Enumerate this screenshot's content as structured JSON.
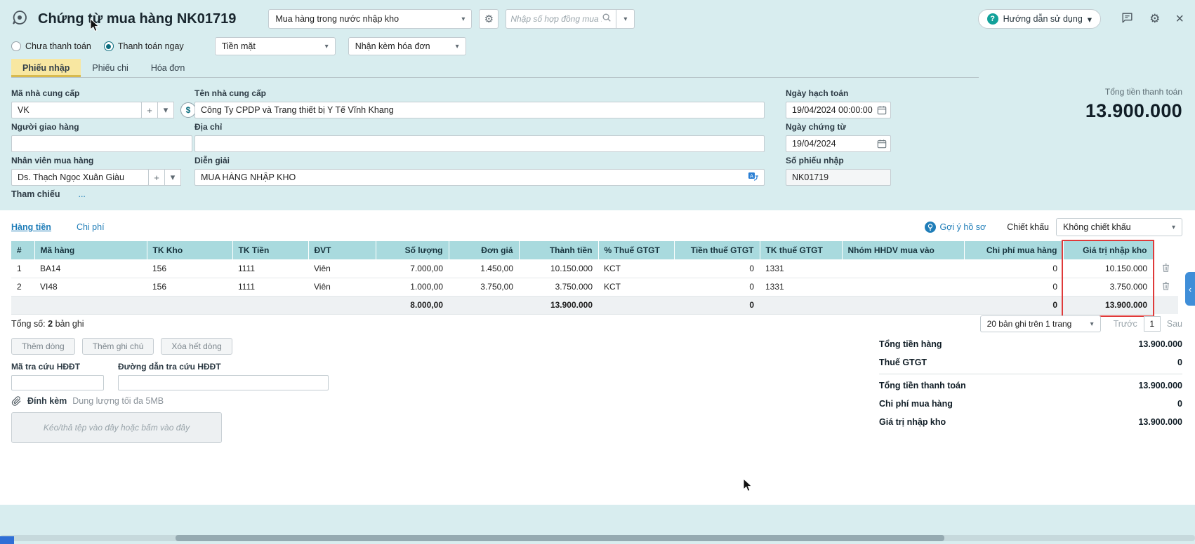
{
  "colors": {
    "background": "#d8edef",
    "table_header": "#a9dade",
    "active_tab_yellow": "#f8e7a1",
    "link_blue": "#1f7db8",
    "highlight_red": "#df3a3a",
    "side_tab_blue": "#3f8ed8"
  },
  "icons": {
    "gear": "⚙",
    "close": "×",
    "chevron_down": "▾",
    "chevron_left": "‹",
    "plus": "+",
    "dollar": "$",
    "question": "?"
  },
  "header": {
    "title": "Chứng từ mua hàng NK01719",
    "doc_type": "Mua hàng trong nước nhập kho",
    "contract_search_placeholder": "Nhập số hợp đồng mua ...",
    "help": "Hướng dẫn sử dụng"
  },
  "payment": {
    "option_unpaid": "Chưa thanh toán",
    "option_paid_now": "Thanh toán ngay",
    "selected_option": "Thanh toán ngay",
    "method": "Tiền mặt",
    "invoice_mode": "Nhận kèm hóa đơn"
  },
  "tabs": [
    "Phiếu nhập",
    "Phiếu chi",
    "Hóa đơn"
  ],
  "active_tab": "Phiếu nhập",
  "form": {
    "supplier_code_label": "Mã nhà cung cấp",
    "supplier_code": "VK",
    "supplier_name_label": "Tên nhà cung cấp",
    "supplier_name": "Công Ty CPDP và Trang thiết bị Y Tế Vĩnh Khang",
    "posting_date_label": "Ngày hạch toán",
    "posting_date": "19/04/2024 00:00:00",
    "total_payment_label": "Tổng tiền thanh toán",
    "total_payment": "13.900.000",
    "deliverer_label": "Người giao hàng",
    "deliverer": "",
    "address_label": "Địa chỉ",
    "address": "",
    "doc_date_label": "Ngày chứng từ",
    "doc_date": "19/04/2024",
    "buyer_label": "Nhân viên mua hàng",
    "buyer": "Ds. Thạch Ngọc Xuân Giàu",
    "description_label": "Diễn giải",
    "description": "MUA HÀNG NHẬP KHO",
    "receipt_no_label": "Số phiếu nhập",
    "receipt_no": "NK01719",
    "reference_label": "Tham chiếu",
    "reference_more": "..."
  },
  "detail": {
    "tab_goods": "Hàng tiền",
    "tab_costs": "Chi phí",
    "suggestion": "Gợi ý hồ sơ",
    "discount_label": "Chiết khấu",
    "discount": "Không chiết khấu"
  },
  "table": {
    "columns": [
      "#",
      "Mã hàng",
      "TK Kho",
      "TK Tiền",
      "ĐVT",
      "Số lượng",
      "Đơn giá",
      "Thành tiền",
      "% Thuế GTGT",
      "Tiền thuế GTGT",
      "TK thuế GTGT",
      "Nhóm HHDV mua vào",
      "Chi phí mua hàng",
      "Giá trị nhập kho"
    ],
    "rows": [
      [
        "1",
        "BA14",
        "156",
        "1111",
        "Viên",
        "7.000,00",
        "1.450,00",
        "10.150.000",
        "KCT",
        "0",
        "1331",
        "",
        "0",
        "10.150.000"
      ],
      [
        "2",
        "VI48",
        "156",
        "1111",
        "Viên",
        "1.000,00",
        "3.750,00",
        "3.750.000",
        "KCT",
        "0",
        "1331",
        "",
        "0",
        "3.750.000"
      ]
    ],
    "totals": {
      "quantity": "8.000,00",
      "amount": "13.900.000",
      "vat": "0",
      "purchase_cost": "0",
      "stock_value": "13.900.000"
    }
  },
  "pagination": {
    "total_prefix": "Tổng số:",
    "total_count": "2",
    "total_suffix": "bản ghi",
    "page_size": "20 bản ghi trên 1 trang",
    "prev": "Trước",
    "page": "1",
    "next": "Sau"
  },
  "actions": {
    "add_row": "Thêm dòng",
    "add_note": "Thêm ghi chú",
    "clear_rows": "Xóa hết dòng"
  },
  "lookup": {
    "code_label": "Mã tra cứu HĐĐT",
    "code": "",
    "url_label": "Đường dẫn tra cứu HĐĐT",
    "url": ""
  },
  "attachment": {
    "label": "Đính kèm",
    "hint": "Dung lượng tối đa 5MB",
    "dropzone": "Kéo/thả tệp vào đây hoặc bấm vào đây"
  },
  "summary": {
    "rows": [
      {
        "label": "Tổng tiền hàng",
        "value": "13.900.000"
      },
      {
        "label": "Thuế GTGT",
        "value": "0"
      },
      {
        "label": "Tổng tiền thanh toán",
        "value": "13.900.000"
      },
      {
        "label": "Chi phí mua hàng",
        "value": "0"
      },
      {
        "label": "Giá trị nhập kho",
        "value": "13.900.000"
      }
    ]
  }
}
